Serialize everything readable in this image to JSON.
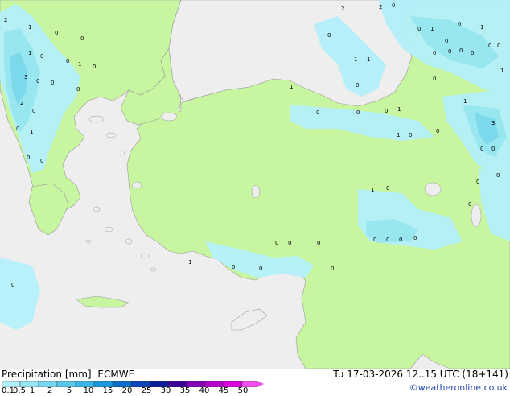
{
  "footer": {
    "product": "Precipitation [mm]",
    "model": "ECMWF",
    "datetime": "Tu 17-03-2026 12..15 UTC (18+141)",
    "credit": "©weatheronline.co.uk"
  },
  "legend": {
    "labels": [
      "0.1",
      "0.5",
      "1",
      "2",
      "5",
      "10",
      "15",
      "20",
      "25",
      "30",
      "35",
      "40",
      "45",
      "50"
    ],
    "colors": [
      "#b4f0fa",
      "#96e6f5",
      "#78d7f0",
      "#5ac8eb",
      "#3cb4e6",
      "#1e96dc",
      "#0a6ec8",
      "#0a46b4",
      "#0a1e96",
      "#3c0096",
      "#8200b4",
      "#b400c8",
      "#dc00dc",
      "#f050f0"
    ]
  },
  "map": {
    "land_color": "#c8f5a0",
    "sea_color": "#eeeeee",
    "border_color": "#9a9a9a",
    "values": [
      {
        "v": "2"
      },
      {
        "v": "1"
      },
      {
        "v": "0"
      },
      {
        "v": "0"
      },
      {
        "v": "1"
      },
      {
        "v": "0"
      },
      {
        "v": "0"
      },
      {
        "v": "1"
      },
      {
        "v": "0"
      },
      {
        "v": "3"
      },
      {
        "v": "0"
      },
      {
        "v": "0"
      },
      {
        "v": "0"
      },
      {
        "v": "2"
      },
      {
        "v": "0"
      },
      {
        "v": "0"
      },
      {
        "v": "1"
      },
      {
        "v": "0"
      },
      {
        "v": "0"
      },
      {
        "v": "2"
      },
      {
        "v": "2"
      },
      {
        "v": "0"
      },
      {
        "v": "0"
      },
      {
        "v": "1"
      },
      {
        "v": "1"
      },
      {
        "v": "0"
      },
      {
        "v": "0"
      },
      {
        "v": "1"
      },
      {
        "v": "0"
      },
      {
        "v": "1"
      },
      {
        "v": "0"
      },
      {
        "v": "0"
      },
      {
        "v": "0"
      },
      {
        "v": "0"
      },
      {
        "v": "0"
      },
      {
        "v": "0"
      },
      {
        "v": "0"
      },
      {
        "v": "0"
      },
      {
        "v": "1"
      },
      {
        "v": "1"
      },
      {
        "v": "3"
      },
      {
        "v": "0"
      },
      {
        "v": "0"
      },
      {
        "v": "0"
      },
      {
        "v": "0"
      },
      {
        "v": "1"
      },
      {
        "v": "0"
      },
      {
        "v": "0"
      },
      {
        "v": "0"
      },
      {
        "v": "1"
      },
      {
        "v": "0"
      },
      {
        "v": "1"
      },
      {
        "v": "0"
      },
      {
        "v": "0"
      },
      {
        "v": "1"
      },
      {
        "v": "0"
      },
      {
        "v": "0"
      },
      {
        "v": "0"
      },
      {
        "v": "0"
      },
      {
        "v": "0"
      },
      {
        "v": "0"
      },
      {
        "v": "0"
      },
      {
        "v": "0"
      },
      {
        "v": "1"
      },
      {
        "v": "0"
      },
      {
        "v": "0"
      },
      {
        "v": "0"
      },
      {
        "v": "0"
      }
    ]
  }
}
